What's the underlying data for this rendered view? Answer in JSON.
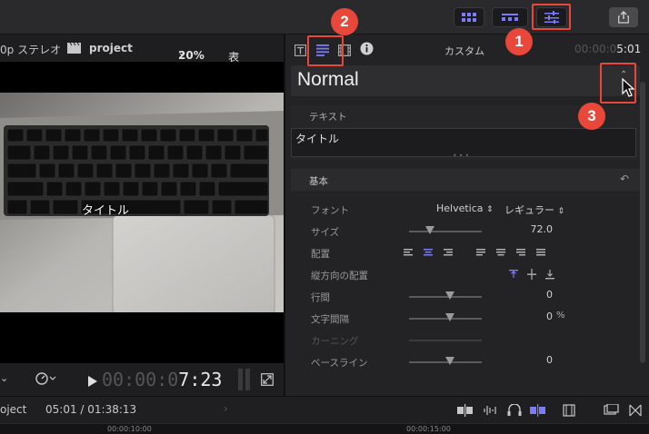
{
  "viewer": {
    "format": "0p ステレオ",
    "project_name": "project",
    "zoom": "20%",
    "display_label": "表示",
    "title_overlay": "タイトル",
    "timecode_dim": "00:00:0",
    "timecode_bright": "7:23"
  },
  "inspector": {
    "header_title": "カスタム",
    "header_timecode_dim": "00:00:0",
    "header_timecode_bright": "5:01",
    "style_name": "Normal",
    "text_section_label": "テキスト",
    "text_value": "タイトル",
    "basic_label": "基本",
    "rows": {
      "font_label": "フォント",
      "font_family": "Helvetica",
      "font_weight": "レギュラー",
      "size_label": "サイズ",
      "size_value": "72.0",
      "align_label": "配置",
      "valign_label": "縦方向の配置",
      "line_spacing_label": "行間",
      "line_spacing_value": "0",
      "tracking_label": "文字間隔",
      "tracking_value": "0",
      "tracking_unit": "%",
      "kerning_label": "カーニング",
      "baseline_label": "ベースライン",
      "baseline_value": "0"
    }
  },
  "timeline": {
    "project_label": "oject",
    "position": "05:01 / 01:38:13",
    "ruler_left": "00:00:10:00",
    "ruler_right": "00:00:15:00"
  },
  "annotations": {
    "n1": "1",
    "n2": "2",
    "n3": "3"
  },
  "colors": {
    "accent": "#7b7bff",
    "annotation_red": "#e8473a"
  }
}
